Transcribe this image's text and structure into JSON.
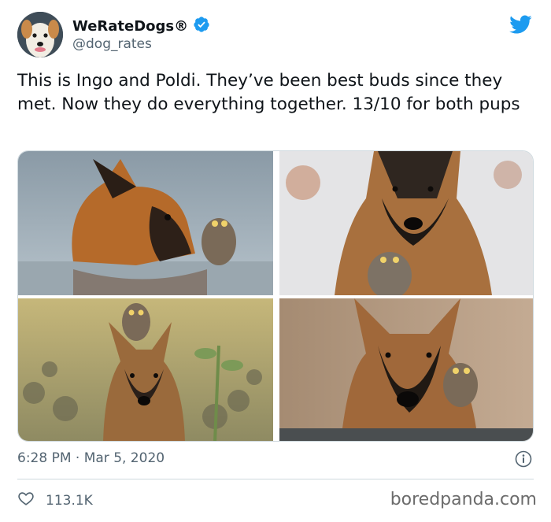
{
  "tweet": {
    "display_name": "WeRateDogs®",
    "handle": "@dog_rates",
    "verified": true,
    "text": "This is Ingo and Poldi. They’ve been best buds since they met. Now they do everything together. 13/10 for both pups",
    "timestamp": "6:28 PM · Mar 5, 2020",
    "likes": "113.1K",
    "photos": [
      {
        "name": "dog-with-owl-on-table-photo"
      },
      {
        "name": "dog-with-owl-in-snow-photo"
      },
      {
        "name": "owl-on-dog-head-in-field-photo"
      },
      {
        "name": "dog-with-owl-on-shoulder-photo"
      }
    ]
  },
  "icons": {
    "verified": "verified-badge-icon",
    "brand": "twitter-bird-icon",
    "info": "info-icon",
    "like": "heart-icon"
  },
  "colors": {
    "brand": "#1d9bf0",
    "text_primary": "#0f1419",
    "text_secondary": "#536471",
    "divider": "#cfd9de"
  },
  "watermark": "boredpanda.com"
}
